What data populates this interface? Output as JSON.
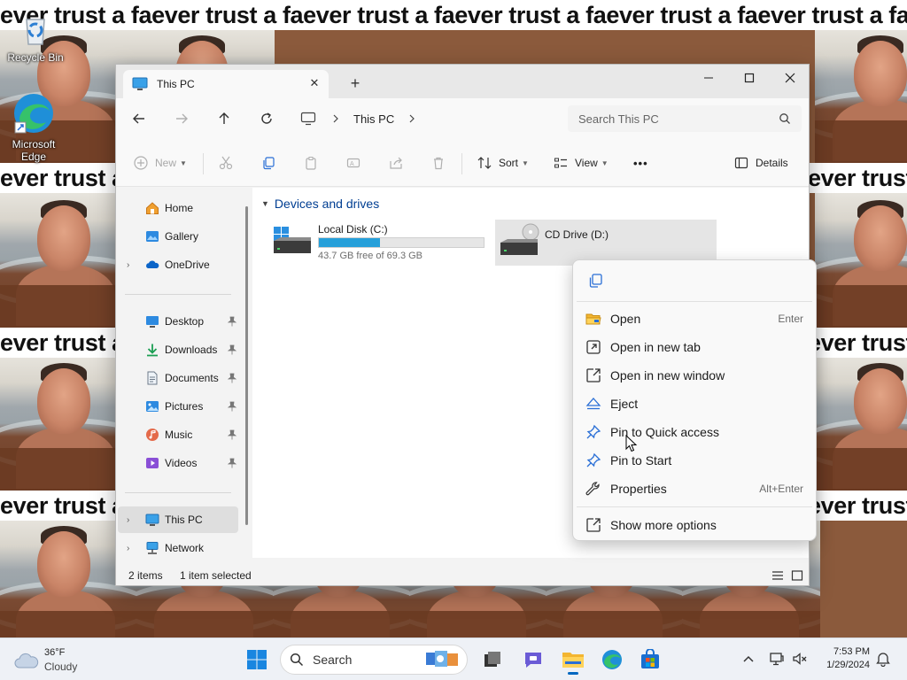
{
  "wallpaper": {
    "banner_text": "ever trust a faever trust a faever trust a faever trust a faever trust a faever trust a faever trust a faever trus",
    "band_text": "ever trust a"
  },
  "desktop": {
    "icons": [
      {
        "label": "Recycle Bin",
        "icon": "recycle-bin-icon"
      },
      {
        "label": "Microsoft Edge",
        "icon": "edge-icon"
      }
    ]
  },
  "window": {
    "tab_title": "This PC",
    "new_tab_symbol": "+",
    "close_tab_symbol": "✕",
    "breadcrumb": [
      "This PC"
    ],
    "search_placeholder": "Search This PC",
    "toolbar": {
      "new_label": "New",
      "sort_label": "Sort",
      "view_label": "View",
      "more_label": "•••",
      "details_label": "Details"
    },
    "nav": {
      "top": [
        {
          "label": "Home",
          "icon": "home-icon"
        },
        {
          "label": "Gallery",
          "icon": "gallery-icon"
        },
        {
          "label": "OneDrive",
          "icon": "onedrive-icon",
          "expandable": true
        }
      ],
      "pinned": [
        {
          "label": "Desktop",
          "icon": "desktop-folder-icon"
        },
        {
          "label": "Downloads",
          "icon": "downloads-icon"
        },
        {
          "label": "Documents",
          "icon": "documents-icon"
        },
        {
          "label": "Pictures",
          "icon": "pictures-icon"
        },
        {
          "label": "Music",
          "icon": "music-icon"
        },
        {
          "label": "Videos",
          "icon": "videos-icon"
        }
      ],
      "bottom": [
        {
          "label": "This PC",
          "icon": "this-pc-icon",
          "selected": true
        },
        {
          "label": "Network",
          "icon": "network-icon"
        }
      ]
    },
    "content": {
      "group_title": "Devices and drives",
      "drives": [
        {
          "name": "Local Disk (C:)",
          "free_text": "43.7 GB free of 69.3 GB",
          "used_fraction": 0.37
        },
        {
          "name": "CD Drive (D:)",
          "selected": true
        }
      ]
    },
    "status": {
      "items_count": "2 items",
      "selection": "1 item selected"
    }
  },
  "context_menu": {
    "items": [
      {
        "label": "Open",
        "accel": "Enter",
        "icon": "folder-open-icon"
      },
      {
        "label": "Open in new tab",
        "accel": "",
        "icon": "new-tab-icon"
      },
      {
        "label": "Open in new window",
        "accel": "",
        "icon": "new-window-icon"
      },
      {
        "label": "Eject",
        "accel": "",
        "icon": "eject-icon"
      },
      {
        "label": "Pin to Quick access",
        "accel": "",
        "icon": "pin-icon"
      },
      {
        "label": "Pin to Start",
        "accel": "",
        "icon": "pin-start-icon"
      },
      {
        "label": "Properties",
        "accel": "Alt+Enter",
        "icon": "wrench-icon"
      }
    ],
    "more_options": {
      "label": "Show more options",
      "icon": "more-options-icon"
    }
  },
  "taskbar": {
    "weather": {
      "temp": "36°F",
      "condition": "Cloudy"
    },
    "search_label": "Search",
    "clock": {
      "time": "7:53 PM",
      "date": "1/29/2024"
    }
  },
  "colors": {
    "accent": "#0067c0",
    "drive_bar": "#26a0da",
    "group_header": "#003e92"
  }
}
